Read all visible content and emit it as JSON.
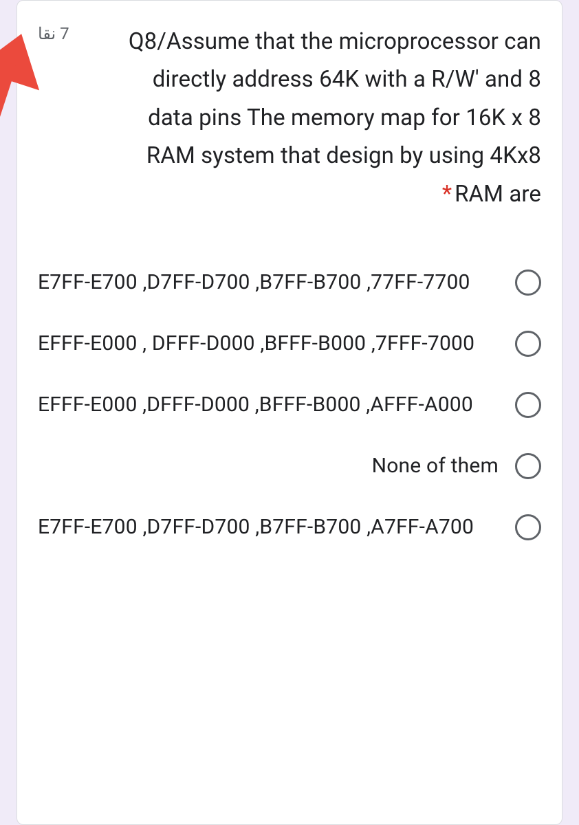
{
  "header": {
    "points": "7 نقا",
    "question": "Q8/Assume that the microprocessor can directly address 64K with a R/W' and 8 data pins The memory map for 16K x 8 RAM system that design by using 4Kx8 RAM are",
    "required_mark": "*"
  },
  "options": [
    {
      "text": "E7FF-E700 ,D7FF-D700 ,B7FF-B700 ,77FF-7700"
    },
    {
      "text": "EFFF-E000 , DFFF-D000 ,BFFF-B000 ,7FFF-7000"
    },
    {
      "text": "EFFF-E000 ,DFFF-D000 ,BFFF-B000 ,AFFF-A000"
    },
    {
      "text": "None of them"
    },
    {
      "text": "E7FF-E700 ,D7FF-D700 ,B7FF-B700 ,A7FF-A700"
    }
  ]
}
